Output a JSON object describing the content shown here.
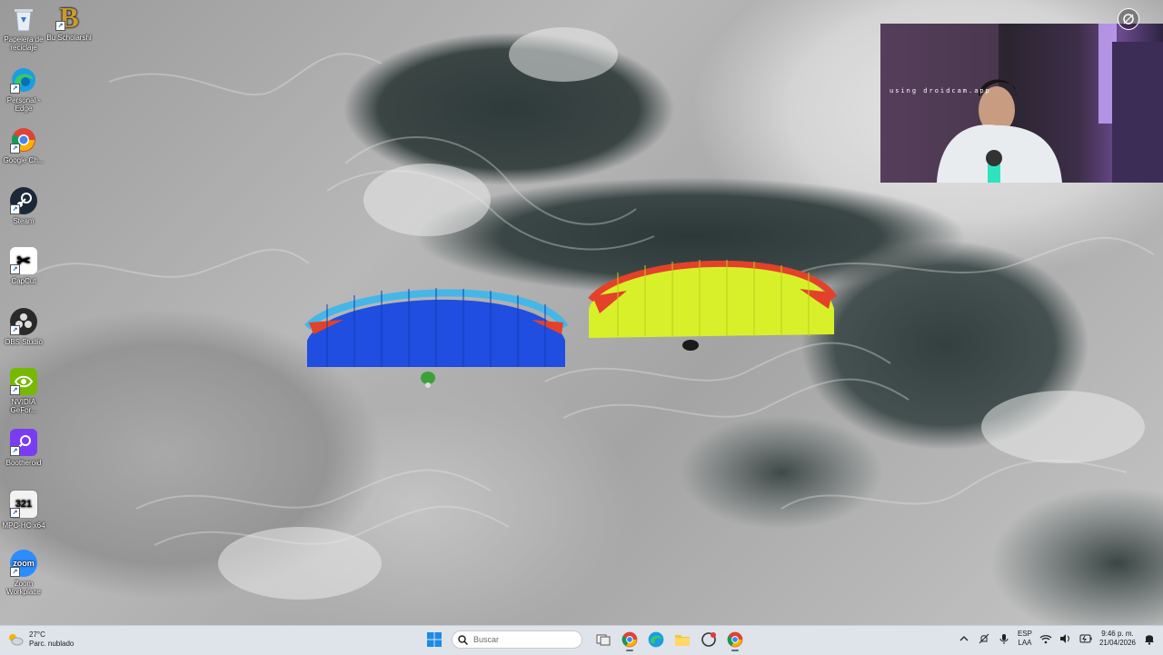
{
  "desktop": {
    "icons": [
      {
        "label": "Papelera de reciclaje",
        "icon": "recycle-bin-icon"
      },
      {
        "label": "Bu Scholarshi",
        "icon": "scholarship-logo-icon"
      },
      {
        "label": "Personal - Edge",
        "icon": "edge-icon"
      },
      {
        "label": "Google Ch...",
        "icon": "chrome-icon"
      },
      {
        "label": "Steam",
        "icon": "steam-icon"
      },
      {
        "label": "CapCut",
        "icon": "capcut-icon"
      },
      {
        "label": "OBS Studio",
        "icon": "obs-icon"
      },
      {
        "label": "NVIDIA GeFor...",
        "icon": "nvidia-icon"
      },
      {
        "label": "Bootheroid",
        "icon": "bootheroid-icon"
      },
      {
        "label": "MPC-HC x64",
        "icon": "mpc-hc-icon"
      },
      {
        "label": "Zoom Workplace",
        "icon": "zoom-icon"
      }
    ]
  },
  "webcam": {
    "watermark": "using droidcam.app"
  },
  "taskbar": {
    "weather": {
      "temp": "27°C",
      "desc": "Parc. nublado"
    },
    "search_placeholder": "Buscar",
    "apps": [
      "start-icon",
      "search",
      "task-view-icon",
      "chrome-icon",
      "edge-icon",
      "file-explorer-icon",
      "capture-app-icon",
      "chrome-icon"
    ],
    "tray": {
      "lang_top": "ESP",
      "lang_bottom": "LAA",
      "time": "9:46 p. m.",
      "date": "21/04/2026"
    }
  },
  "colors": {
    "taskbar_bg": "#dfe3ea",
    "glider_blue": "#1f4ee0",
    "glider_yellow": "#d8f02a",
    "accent_red": "#e4412a"
  }
}
